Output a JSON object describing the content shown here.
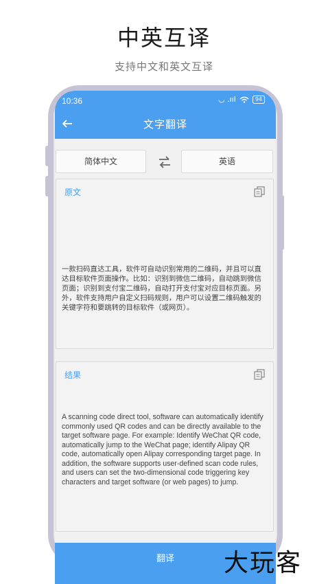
{
  "promo": {
    "title": "中英互译",
    "subtitle": "支持中文和英文互译"
  },
  "status_bar": {
    "time": "10:36",
    "signal": "◡ .ııl",
    "battery": "94"
  },
  "header": {
    "title": "文字翻译",
    "back_icon": "arrow-left-icon"
  },
  "languages": {
    "source": "简体中文",
    "target": "英语",
    "swap_icon": "swap-icon"
  },
  "source_panel": {
    "label": "原文",
    "copy_icon": "copy-icon",
    "text": "一款扫码直达工具，软件可自动识别常用的二维码，并且可以直达目标软件页面操作。比如：识别到微信二维码，自动跳到微信页面；识别到支付宝二维码，自动打开支付宝对应目标页面。另外，软件支持用户自定义扫码规则，用户可以设置二维码触发的关键字符和要跳转的目标软件（或网页）。"
  },
  "result_panel": {
    "label": "结果",
    "copy_icon": "copy-icon",
    "text": "A scanning code direct tool, software can automatically identify commonly used QR codes and can be directly available to the target software page. For example: Identify WeChat QR code, automatically jump to the WeChat page; identify Alipay QR code, automatically open Alipay corresponding target page. In addition, the software supports user-defined scan code rules, and users can set the two-dimensional code triggering key characters and target software (or web pages) to jump."
  },
  "translate_button": "翻译",
  "watermark": "大玩客",
  "colors": {
    "accent": "#4a9ff0",
    "frame": "#c6c4d4"
  }
}
